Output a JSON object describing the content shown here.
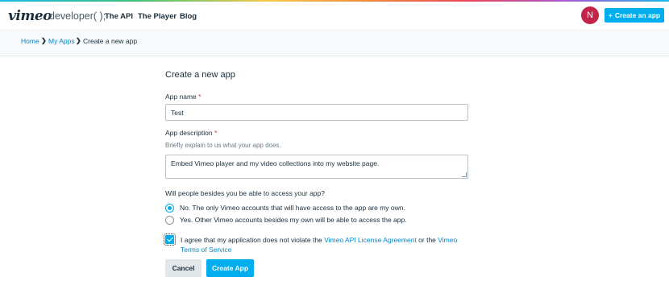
{
  "header": {
    "logo": "vimeo",
    "logo_sub": "developer( );",
    "nav": [
      "The API",
      "The Player",
      "Blog"
    ],
    "avatar_initial": "N",
    "create_button": "Create an app",
    "create_button_icon": "+"
  },
  "breadcrumb": {
    "home": "Home",
    "my_apps": "My Apps",
    "current": "Create a new app",
    "separator": "❯"
  },
  "form": {
    "title": "Create a new app",
    "app_name_label": "App name",
    "required_mark": "*",
    "app_name_value": "Test",
    "app_description_label": "App description",
    "app_description_hint": "Briefly explain to us what your app does.",
    "app_description_value": "Embed Vimeo player and my video collections into my website page.",
    "access_question": "Will people besides you be able to access your app?",
    "access_options": [
      {
        "label": "No. The only Vimeo accounts that will have access to the app are my own.",
        "selected": true
      },
      {
        "label": "Yes. Other Vimeo accounts besides my own will be able to access the app.",
        "selected": false
      }
    ],
    "agree_checked": true,
    "agree_text_1": "I agree that my application does not violate the ",
    "agree_link_1": "Vimeo API License Agreement",
    "agree_text_2": " or the ",
    "agree_link_2": "Vimeo Terms of Service",
    "cancel_label": "Cancel",
    "create_label": "Create App"
  },
  "colors": {
    "accent": "#00adef",
    "link": "#0088cc",
    "avatar": "#c4244a",
    "required": "#d32f2f"
  }
}
